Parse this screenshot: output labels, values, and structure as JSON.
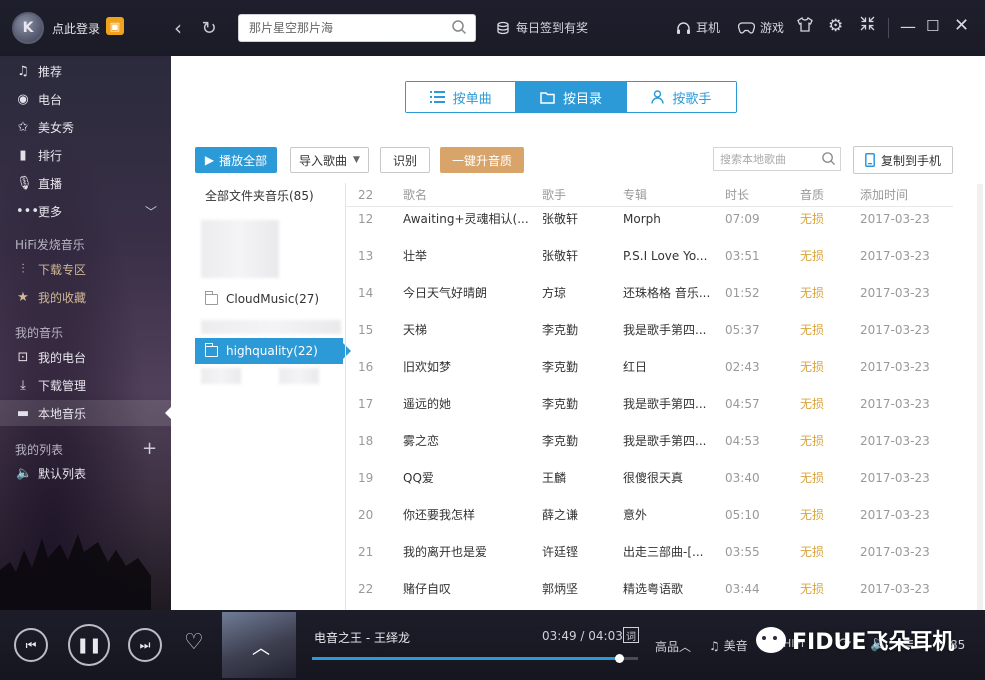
{
  "topbar": {
    "login_label": "点此登录",
    "search_placeholder": "那片星空那片海",
    "signin_label": "每日签到有奖",
    "headphone_label": "耳机",
    "game_label": "游戏"
  },
  "sidebar": {
    "nav": [
      {
        "icon": "music-note-icon",
        "label": "推荐"
      },
      {
        "icon": "radio-icon",
        "label": "电台"
      },
      {
        "icon": "star-icon",
        "label": "美女秀"
      },
      {
        "icon": "ranking-icon",
        "label": "排行"
      },
      {
        "icon": "microphone-icon",
        "label": "直播"
      },
      {
        "icon": "more-icon",
        "label": "更多"
      }
    ],
    "hifi_heading": "HiFi发烧音乐",
    "hifi_items": [
      {
        "icon": "waveform-icon",
        "label": "下载专区"
      },
      {
        "icon": "star-icon",
        "label": "我的收藏"
      }
    ],
    "my_music_heading": "我的音乐",
    "my_music_items": [
      {
        "icon": "radio-box-icon",
        "label": "我的电台"
      },
      {
        "icon": "download-icon",
        "label": "下载管理"
      },
      {
        "icon": "monitor-icon",
        "label": "本地音乐"
      }
    ],
    "my_list_heading": "我的列表",
    "list_items": [
      {
        "icon": "speaker-icon",
        "label": "默认列表"
      }
    ]
  },
  "main": {
    "view_tabs": [
      {
        "icon": "list-icon",
        "label": "按单曲",
        "selected": false
      },
      {
        "icon": "folder-icon",
        "label": "按目录",
        "selected": true
      },
      {
        "icon": "person-icon",
        "label": "按歌手",
        "selected": false
      }
    ],
    "toolbar": {
      "play_all": "播放全部",
      "import": "导入歌曲",
      "identify": "识别",
      "upgrade": "一键升音质",
      "search_placeholder": "搜索本地歌曲",
      "copy_to_phone": "复制到手机"
    },
    "folders": {
      "all_label": "全部文件夹音乐(85)",
      "items": [
        {
          "label": "CloudMusic(27)",
          "selected": false
        },
        {
          "label": "highquality(22)",
          "selected": true
        }
      ]
    },
    "table": {
      "header": {
        "no": "22",
        "name": "歌名",
        "artist": "歌手",
        "album": "专辑",
        "duration": "时长",
        "quality": "音质",
        "date": "添加时间"
      },
      "rows": [
        {
          "no": "12",
          "name": "Awaiting+灵魂相认(...",
          "artist": "张敬轩",
          "album": "Morph",
          "duration": "07:09",
          "quality": "无损",
          "date": "2017-03-23"
        },
        {
          "no": "13",
          "name": "壮举",
          "artist": "张敬轩",
          "album": "P.S.I Love Yo...",
          "duration": "03:51",
          "quality": "无损",
          "date": "2017-03-23"
        },
        {
          "no": "14",
          "name": "今日天气好晴朗",
          "artist": "方琼",
          "album": "还珠格格 音乐...",
          "duration": "01:52",
          "quality": "无损",
          "date": "2017-03-23"
        },
        {
          "no": "15",
          "name": "天梯",
          "artist": "李克勤",
          "album": "我是歌手第四...",
          "duration": "05:37",
          "quality": "无损",
          "date": "2017-03-23"
        },
        {
          "no": "16",
          "name": "旧欢如梦",
          "artist": "李克勤",
          "album": "红日",
          "duration": "02:43",
          "quality": "无损",
          "date": "2017-03-23"
        },
        {
          "no": "17",
          "name": "遥远的她",
          "artist": "李克勤",
          "album": "我是歌手第四...",
          "duration": "04:57",
          "quality": "无损",
          "date": "2017-03-23"
        },
        {
          "no": "18",
          "name": "雾之恋",
          "artist": "李克勤",
          "album": "我是歌手第四...",
          "duration": "04:53",
          "quality": "无损",
          "date": "2017-03-23"
        },
        {
          "no": "19",
          "name": "QQ爱",
          "artist": "王麟",
          "album": "很傻很天真",
          "duration": "03:40",
          "quality": "无损",
          "date": "2017-03-23"
        },
        {
          "no": "20",
          "name": "你还要我怎样",
          "artist": "薛之谦",
          "album": "意外",
          "duration": "05:10",
          "quality": "无损",
          "date": "2017-03-23"
        },
        {
          "no": "21",
          "name": "我的离开也是爱",
          "artist": "许廷铿",
          "album": "出走三部曲-[...",
          "duration": "03:55",
          "quality": "无损",
          "date": "2017-03-23"
        },
        {
          "no": "22",
          "name": "赌仔自叹",
          "artist": "郭炳坚",
          "album": "精选粤语歌",
          "duration": "03:44",
          "quality": "无损",
          "date": "2017-03-23"
        }
      ]
    }
  },
  "player": {
    "now_playing": "电音之王 - 王绎龙",
    "time": "03:49 / 04:03",
    "progress": 0.942,
    "lyric_label": "词",
    "quality_label": "高品",
    "effect_label": "美音",
    "hifi_label": "HIFI",
    "count_label": "85",
    "watermark": "FIDUE飞朵耳机"
  },
  "colors": {
    "accent": "#2d9ad8",
    "lossless": "#d9a43e",
    "upgrade_button": "#d9a46a"
  }
}
